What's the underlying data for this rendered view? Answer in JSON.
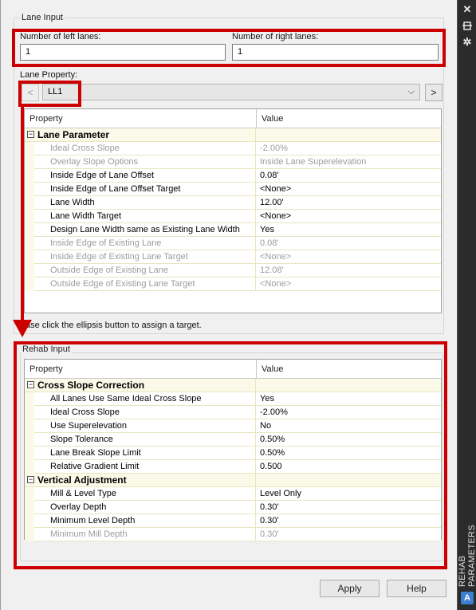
{
  "lane_input": {
    "group_label": "Lane Input",
    "left_lanes_label": "Number of left lanes:",
    "left_lanes_value": "1",
    "right_lanes_label": "Number of right lanes:",
    "right_lanes_value": "1",
    "lane_property_label": "Lane Property:",
    "prev_label": "<",
    "next_label": ">",
    "lane_selected": "LL1",
    "grid": {
      "col_property": "Property",
      "col_value": "Value",
      "rows": [
        {
          "cat": true,
          "property": "Lane Parameter",
          "value": ""
        },
        {
          "property": "Ideal Cross Slope",
          "value": "-2.00%",
          "disabled": true
        },
        {
          "property": "Overlay Slope Options",
          "value": "Inside Lane Superelevation",
          "disabled": true
        },
        {
          "property": "Inside Edge of Lane Offset",
          "value": "0.08'"
        },
        {
          "property": "Inside Edge of Lane Offset Target",
          "value": "<None>"
        },
        {
          "property": "Lane Width",
          "value": "12.00'"
        },
        {
          "property": "Lane Width Target",
          "value": "<None>"
        },
        {
          "property": "Design Lane Width same as Existing Lane Width",
          "value": "Yes"
        },
        {
          "property": "Inside Edge of Existing Lane",
          "value": "0.08'",
          "disabled": true
        },
        {
          "property": "Inside Edge of Existing Lane Target",
          "value": "<None>",
          "disabled": true
        },
        {
          "property": "Outside Edge of Existing Lane",
          "value": "12.08'",
          "disabled": true
        },
        {
          "property": "Outside Edge of Existing Lane Target",
          "value": "<None>",
          "disabled": true
        }
      ]
    },
    "hint": "ase click the ellipsis button to assign a target."
  },
  "rehab_input": {
    "group_label": "Rehab Input",
    "grid": {
      "col_property": "Property",
      "col_value": "Value",
      "rows": [
        {
          "cat": true,
          "property": "Cross Slope Correction",
          "value": ""
        },
        {
          "property": "All Lanes Use Same Ideal Cross Slope",
          "value": "Yes"
        },
        {
          "property": "Ideal Cross Slope",
          "value": "-2.00%"
        },
        {
          "property": "Use Superelevation",
          "value": "No"
        },
        {
          "property": "Slope Tolerance",
          "value": "0.50%"
        },
        {
          "property": "Lane Break Slope Limit",
          "value": "0.50%"
        },
        {
          "property": "Relative Gradient Limit",
          "value": "0.500"
        },
        {
          "cat": true,
          "property": "Vertical Adjustment",
          "value": ""
        },
        {
          "property": "Mill & Level Type",
          "value": "Level Only"
        },
        {
          "property": "Overlay Depth",
          "value": "0.30'"
        },
        {
          "property": "Minimum Level Depth",
          "value": "0.30'"
        },
        {
          "property": "Minimum Mill Depth",
          "value": "0.30'",
          "disabled": true
        }
      ]
    }
  },
  "buttons": {
    "apply": "Apply",
    "help": "Help"
  },
  "sidebar": {
    "close_glyph": "✕",
    "title": "REHAB PARAMETERS",
    "logo": "A"
  },
  "colors": {
    "annotation_red": "#cc0000",
    "category_bg": "#fbf9e8",
    "disabled_text": "#9c9c9c"
  }
}
